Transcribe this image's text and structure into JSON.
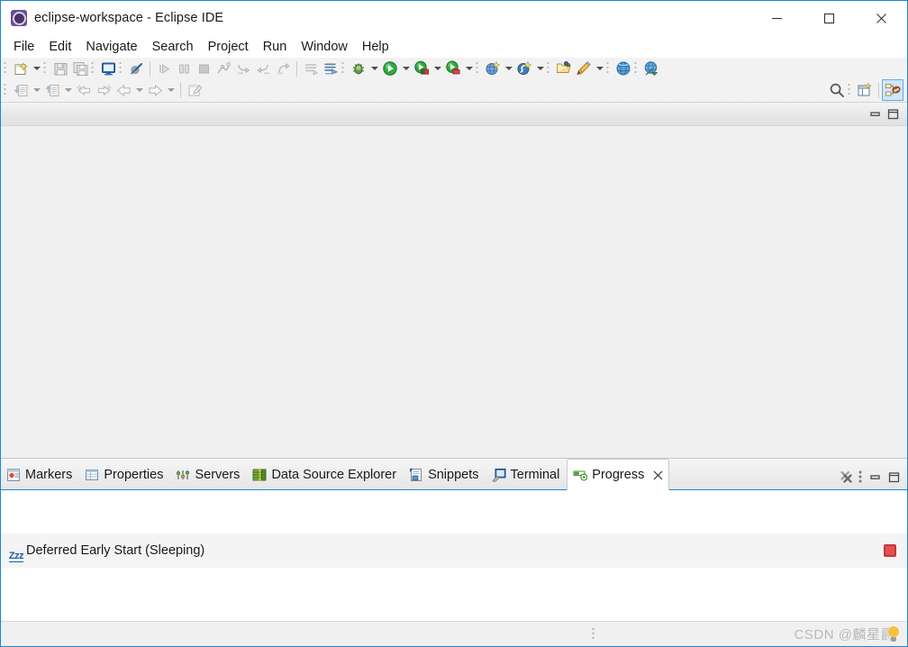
{
  "window": {
    "title": "eclipse-workspace - Eclipse IDE",
    "app_icon": "eclipse-icon",
    "controls": {
      "minimize": "minimize-icon",
      "maximize": "maximize-icon",
      "close": "close-icon"
    }
  },
  "menubar": {
    "items": [
      {
        "label": "File"
      },
      {
        "label": "Edit"
      },
      {
        "label": "Navigate"
      },
      {
        "label": "Search"
      },
      {
        "label": "Project"
      },
      {
        "label": "Run"
      },
      {
        "label": "Window"
      },
      {
        "label": "Help"
      }
    ]
  },
  "toolbar": {
    "row1": [
      {
        "name": "new-wizard-button",
        "icon": "new-file-icon",
        "enabled": true,
        "dropdown": true
      },
      {
        "name": "save-button",
        "icon": "save-icon",
        "enabled": false
      },
      {
        "name": "save-all-button",
        "icon": "save-all-icon",
        "enabled": false
      },
      {
        "name": "new-java-console-button",
        "icon": "console-icon",
        "enabled": true
      },
      {
        "name": "toggle-breakpoint-button",
        "icon": "breakpoint-skip-icon",
        "enabled": true
      },
      {
        "name": "resume-button",
        "icon": "resume-icon",
        "enabled": false
      },
      {
        "name": "suspend-button",
        "icon": "suspend-icon",
        "enabled": false
      },
      {
        "name": "terminate-button",
        "icon": "terminate-icon",
        "enabled": false
      },
      {
        "name": "disconnect-button",
        "icon": "disconnect-icon",
        "enabled": false
      },
      {
        "name": "step-into-button",
        "icon": "step-into-icon",
        "enabled": false
      },
      {
        "name": "step-over-button",
        "icon": "step-over-icon",
        "enabled": false
      },
      {
        "name": "step-return-button",
        "icon": "step-return-icon",
        "enabled": false
      },
      {
        "name": "skip-all-breakpoints-button",
        "icon": "skip-breakpoints-icon",
        "enabled": false
      },
      {
        "name": "edit-breakpoint-button",
        "icon": "edit-breakpoint-icon",
        "enabled": true
      },
      {
        "name": "debug-button",
        "icon": "debug-bug-icon",
        "enabled": true,
        "dropdown": true
      },
      {
        "name": "run-button",
        "icon": "run-green-icon",
        "enabled": true,
        "dropdown": true
      },
      {
        "name": "coverage-button",
        "icon": "coverage-icon",
        "enabled": true,
        "dropdown": true
      },
      {
        "name": "run-external-tools-button",
        "icon": "external-tools-icon",
        "enabled": true,
        "dropdown": true
      },
      {
        "name": "new-server-button",
        "icon": "new-server-icon",
        "enabled": true,
        "dropdown": true
      },
      {
        "name": "new-connection-profile-button",
        "icon": "connection-profile-icon",
        "enabled": true,
        "dropdown": true
      },
      {
        "name": "open-type-button",
        "icon": "open-folder-icon",
        "enabled": true
      },
      {
        "name": "new-annotation-button",
        "icon": "pencil-icon",
        "enabled": true,
        "dropdown": true
      },
      {
        "name": "open-web-browser-button",
        "icon": "globe-icon",
        "enabled": true
      },
      {
        "name": "open-external-browser-button",
        "icon": "globe-run-icon",
        "enabled": true
      }
    ],
    "row2": [
      {
        "name": "import-button",
        "icon": "import-icon",
        "enabled": false,
        "dropdown": true
      },
      {
        "name": "export-button",
        "icon": "export-icon",
        "enabled": false,
        "dropdown": true
      },
      {
        "name": "previous-annotation-button",
        "icon": "prev-annotation-icon",
        "enabled": false
      },
      {
        "name": "next-annotation-button",
        "icon": "next-annotation-icon",
        "enabled": false
      },
      {
        "name": "back-button",
        "icon": "back-arrow-icon",
        "enabled": false,
        "dropdown": true
      },
      {
        "name": "forward-button",
        "icon": "forward-arrow-icon",
        "enabled": false,
        "dropdown": true
      },
      {
        "name": "new-editor-button",
        "icon": "new-editor-icon",
        "enabled": false
      }
    ],
    "right": [
      {
        "name": "quick-access-search-button",
        "icon": "search-icon"
      },
      {
        "name": "open-perspective-button",
        "icon": "open-perspective-icon"
      },
      {
        "name": "java-ee-perspective-button",
        "icon": "java-ee-perspective-icon",
        "active": true
      }
    ]
  },
  "editor": {
    "controls": [
      {
        "name": "minimize-editor-area-button",
        "icon": "minimize-view-icon"
      },
      {
        "name": "maximize-editor-area-button",
        "icon": "maximize-view-icon"
      }
    ]
  },
  "bottom_panel": {
    "tabs": [
      {
        "label": "Markers",
        "icon": "markers-icon",
        "active": false,
        "closable": false
      },
      {
        "label": "Properties",
        "icon": "properties-icon",
        "active": false,
        "closable": false
      },
      {
        "label": "Servers",
        "icon": "servers-icon",
        "active": false,
        "closable": false
      },
      {
        "label": "Data Source Explorer",
        "icon": "data-source-explorer-icon",
        "active": false,
        "closable": false
      },
      {
        "label": "Snippets",
        "icon": "snippets-icon",
        "active": false,
        "closable": false
      },
      {
        "label": "Terminal",
        "icon": "terminal-icon",
        "active": false,
        "closable": false
      },
      {
        "label": "Progress",
        "icon": "progress-icon",
        "active": true,
        "closable": true
      }
    ],
    "controls": [
      {
        "name": "remove-all-finished-button",
        "icon": "remove-all-icon"
      },
      {
        "name": "view-menu-button",
        "icon": "view-menu-dots-icon"
      },
      {
        "name": "minimize-view-button",
        "icon": "minimize-view-icon"
      },
      {
        "name": "maximize-view-button",
        "icon": "maximize-view-icon"
      }
    ],
    "progress": {
      "items": [
        {
          "label": "Deferred Early Start (Sleeping)",
          "state_icon": "sleeping-zzz-icon",
          "stop_button": "stop-job-icon"
        }
      ]
    }
  },
  "statusbar": {
    "resize_grip": "drag-handle-icon",
    "watermark": "CSDN @麟星爵",
    "watermark_icon": "lightbulb-icon"
  },
  "colors": {
    "window_border": "#1b87d8",
    "toolbar_bg": "#f2f2f2",
    "editor_bg": "#f0f0f0",
    "active_tab_bg": "#ffffff",
    "progress_row_bg": "#f4f4f4",
    "stop_red": "#e05055",
    "zzz_blue": "#1a5fa8",
    "perspective_active": "#cfe6fb"
  }
}
